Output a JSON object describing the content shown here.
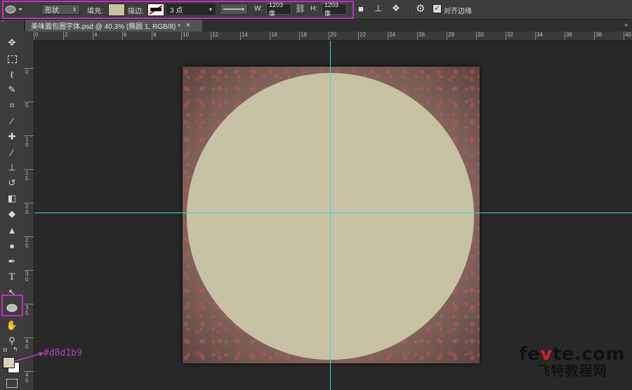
{
  "options_bar": {
    "shape_mode": "形状",
    "fill_label": "填充:",
    "fill_color": "#c8c2a4",
    "stroke_label": "描边:",
    "stroke_width": "3 点",
    "w_label": "W:",
    "w_value": "1203 像",
    "h_label": "H:",
    "h_value": "1203 像",
    "align_edges_label": "对齐边缘",
    "align_edges_checked": true
  },
  "document_tab": {
    "title": "美味面包圈字体.psd @ 40.3% (椭圆 1, RGB/8) *",
    "close": "×"
  },
  "ruler_h_ticks": [
    "0",
    "2",
    "4",
    "6",
    "8",
    "10",
    "12",
    "14",
    "16",
    "18",
    "20",
    "22",
    "24",
    "26",
    "28",
    "30",
    "32",
    "34",
    "36",
    "38",
    "40"
  ],
  "ruler_v_ticks": [
    "0",
    "5",
    "10",
    "15",
    "20",
    "25",
    "30",
    "35",
    "40",
    "45"
  ],
  "colors": {
    "foreground": "#d8d1b9",
    "background": "#ffffff",
    "ellipse": "#c8c2a4",
    "guide": "#3fd6e0",
    "highlight": "#c02fc0"
  },
  "annotation": "#d8d1b9",
  "watermark": {
    "line1_prefix": "fe",
    "line1_accent": "v",
    "line1_suffix": "te.com",
    "line2": "飞特教程网"
  },
  "tools": [
    "move-icon",
    "marquee-icon",
    "lasso-icon",
    "quick-select-icon",
    "crop-icon",
    "eyedropper-icon",
    "healing-icon",
    "brush-icon",
    "stamp-icon",
    "history-brush-icon",
    "eraser-icon",
    "bucket-icon",
    "blur-icon",
    "dodge-icon",
    "pen-icon",
    "type-icon",
    "path-select-icon",
    "ellipse-tool-icon",
    "hand-icon",
    "zoom-icon"
  ]
}
